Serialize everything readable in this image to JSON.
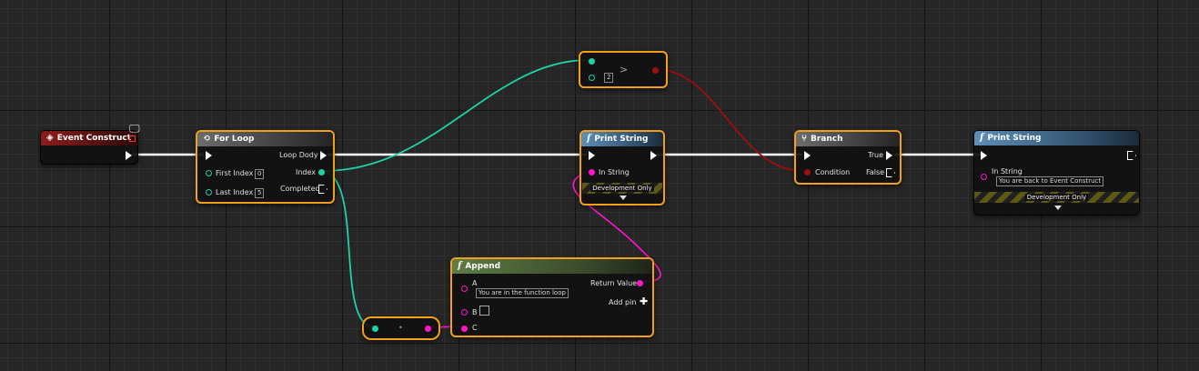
{
  "colors": {
    "exec_wire": "#ffffff",
    "integer_wire": "#1ed2a8",
    "string_wire": "#ff16c8",
    "boolean_wire": "#a00e0e",
    "selection_outline": "#f2a019"
  },
  "event_construct": {
    "title": "Event Construct",
    "icon": "event-diamond-icon"
  },
  "for_loop": {
    "title": "For Loop",
    "loop_body": "Loop Dody",
    "first_index_label": "First Index",
    "first_index_value": "0",
    "index_label": "Index",
    "last_index_label": "Last Index",
    "last_index_value": "5",
    "completed_label": "Completed"
  },
  "compare": {
    "operator": ">",
    "value": "2"
  },
  "print_string_1": {
    "title": "Print String",
    "in_string_label": "In String",
    "dev_label": "Development Only"
  },
  "branch": {
    "title": "Branch",
    "condition_label": "Condition",
    "true_label": "True",
    "false_label": "False"
  },
  "print_string_2": {
    "title": "Print String",
    "in_string_label": "In String",
    "in_string_value": "You are back to Event Construct",
    "dev_label": "Development Only"
  },
  "append": {
    "title": "Append",
    "a_label": "A",
    "a_value": "You are in the function loop",
    "b_label": "B",
    "c_label": "C",
    "return_label": "Return Value",
    "add_pin_label": "Add pin",
    "add_pin_icon": "plus"
  },
  "conversion": {
    "symbol": "•"
  }
}
